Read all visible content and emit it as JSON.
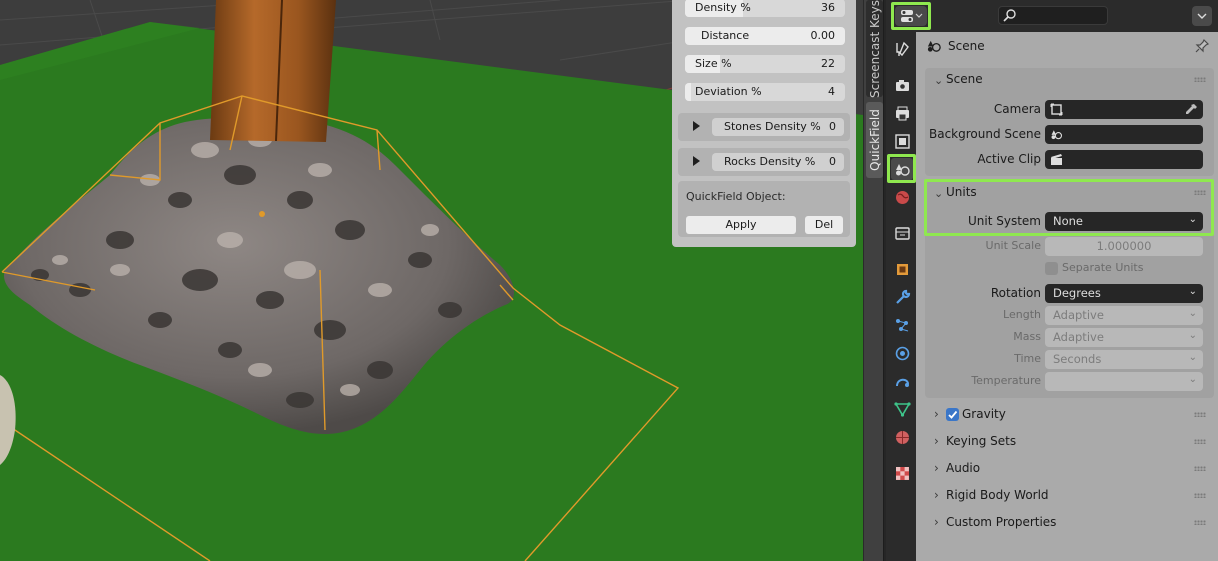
{
  "viewport": {
    "colors": {
      "background": "#3d3d3d",
      "ground": "#2b7a1f",
      "selection_outline": "#e09a2a",
      "post": "#9c5a1f"
    },
    "objects": [
      "grid-floor",
      "rock-pile",
      "wooden-post",
      "bounding-box"
    ]
  },
  "sidebar_tabs": [
    {
      "label": "Screencast Keys"
    },
    {
      "label": "QuickField"
    }
  ],
  "quickfield": {
    "fields": [
      {
        "label": "Density %",
        "value": "36",
        "fill": 0.36
      },
      {
        "label": "Distance",
        "value": "0.00",
        "fill": null
      },
      {
        "label": "Size %",
        "value": "22",
        "fill": 0.22
      },
      {
        "label": "Deviation %",
        "value": "4",
        "fill": 0.04
      }
    ],
    "subpanels": [
      {
        "label": "Stones Density %",
        "value": "0"
      },
      {
        "label": "Rocks Density %",
        "value": "0"
      }
    ],
    "object_label": "QuickField Object:",
    "apply_label": "Apply",
    "del_label": "Del"
  },
  "properties": {
    "header": {
      "editor_type_icon": "properties-editor-icon",
      "search_placeholder": "",
      "options_icon": "chevron-down-icon"
    },
    "context_title": "Scene",
    "tabs": [
      {
        "name": "tool-tab",
        "icon": "wrench-screwdriver-icon"
      },
      {
        "name": "render-tab",
        "icon": "camera-back-icon"
      },
      {
        "name": "output-tab",
        "icon": "printer-icon"
      },
      {
        "name": "view-layer-tab",
        "icon": "image-stack-icon"
      },
      {
        "name": "scene-tab",
        "icon": "scene-icon",
        "active": true
      },
      {
        "name": "world-tab",
        "icon": "world-icon"
      },
      {
        "name": "collection-tab",
        "icon": "collection-box-icon"
      },
      {
        "name": "object-tab",
        "icon": "object-square-icon"
      },
      {
        "name": "modifiers-tab",
        "icon": "wrench-icon"
      },
      {
        "name": "particles-tab",
        "icon": "particles-icon"
      },
      {
        "name": "physics-tab",
        "icon": "physics-orbit-icon"
      },
      {
        "name": "constraints-tab",
        "icon": "constraint-icon"
      },
      {
        "name": "data-tab",
        "icon": "mesh-data-icon"
      },
      {
        "name": "material-tab",
        "icon": "material-sphere-icon"
      },
      {
        "name": "texture-tab",
        "icon": "checker-texture-icon"
      }
    ],
    "scene_panel": {
      "title": "Scene",
      "camera_label": "Camera",
      "camera_value": "",
      "background_label": "Background Scene",
      "background_value": "",
      "clip_label": "Active Clip",
      "clip_value": ""
    },
    "units_panel": {
      "title": "Units",
      "unit_system_label": "Unit System",
      "unit_system_value": "None",
      "unit_scale_label": "Unit Scale",
      "unit_scale_value": "1.000000",
      "separate_units_label": "Separate Units",
      "separate_units_checked": false,
      "rotation_label": "Rotation",
      "rotation_value": "Degrees",
      "length_label": "Length",
      "length_value": "Adaptive",
      "mass_label": "Mass",
      "mass_value": "Adaptive",
      "time_label": "Time",
      "time_value": "Seconds",
      "temperature_label": "Temperature",
      "temperature_value": ""
    },
    "collapsed_panels": [
      {
        "title": "Gravity",
        "checkbox": true,
        "checked": true
      },
      {
        "title": "Keying Sets"
      },
      {
        "title": "Audio"
      },
      {
        "title": "Rigid Body World"
      },
      {
        "title": "Custom Properties"
      }
    ],
    "highlight_color": "#8fe84f"
  }
}
